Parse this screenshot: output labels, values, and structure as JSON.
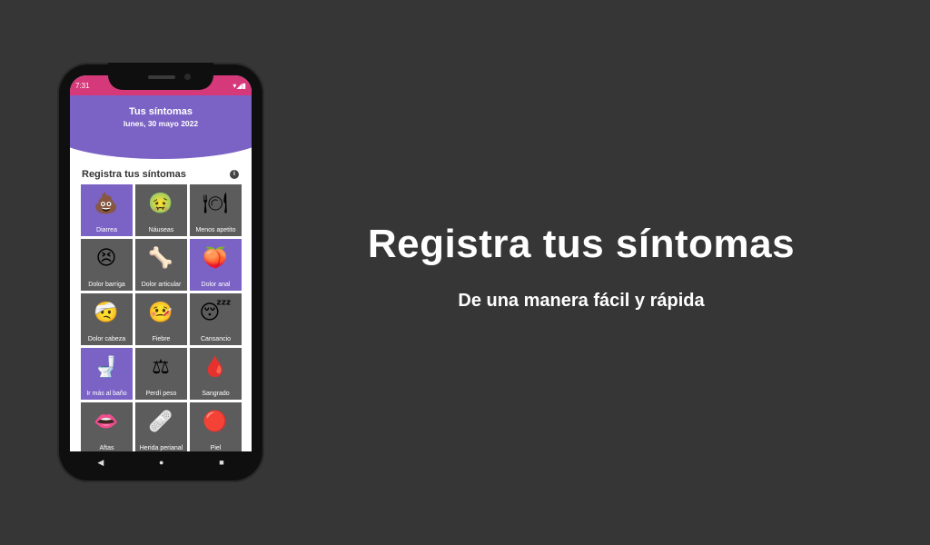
{
  "status": {
    "time": "7:31",
    "gear": "gear-icon",
    "right": "▾◢▮"
  },
  "header": {
    "title": "Tus síntomas",
    "date": "lunes, 30 mayo 2022"
  },
  "section": {
    "title": "Registra tus síntomas",
    "info": "i"
  },
  "symptoms": [
    {
      "label": "Diarrea",
      "emoji": "💩",
      "selected": true
    },
    {
      "label": "Náuseas",
      "emoji": "🤢",
      "selected": false
    },
    {
      "label": "Menos apetito",
      "emoji": "🍽",
      "selected": false
    },
    {
      "label": "Dolor barriga",
      "emoji": "😣",
      "selected": false
    },
    {
      "label": "Dolor articular",
      "emoji": "🦴",
      "selected": false
    },
    {
      "label": "Dolor anal",
      "emoji": "🍑",
      "selected": true
    },
    {
      "label": "Dolor cabeza",
      "emoji": "🤕",
      "selected": false
    },
    {
      "label": "Fiebre",
      "emoji": "🤒",
      "selected": false
    },
    {
      "label": "Cansancio",
      "emoji": "😴",
      "selected": false
    },
    {
      "label": "Ir más al baño",
      "emoji": "🚽",
      "selected": true
    },
    {
      "label": "Perdí peso",
      "emoji": "⚖",
      "selected": false
    },
    {
      "label": "Sangrado",
      "emoji": "🩸",
      "selected": false
    },
    {
      "label": "Aftas",
      "emoji": "👄",
      "selected": false
    },
    {
      "label": "Herida perianal",
      "emoji": "🩹",
      "selected": false
    },
    {
      "label": "Piel",
      "emoji": "🔴",
      "selected": false
    }
  ],
  "nav": {
    "back": "◀",
    "home": "●",
    "recent": "■"
  },
  "promo": {
    "headline": "Registra tus síntomas",
    "subline": "De una manera fácil y rápida"
  }
}
